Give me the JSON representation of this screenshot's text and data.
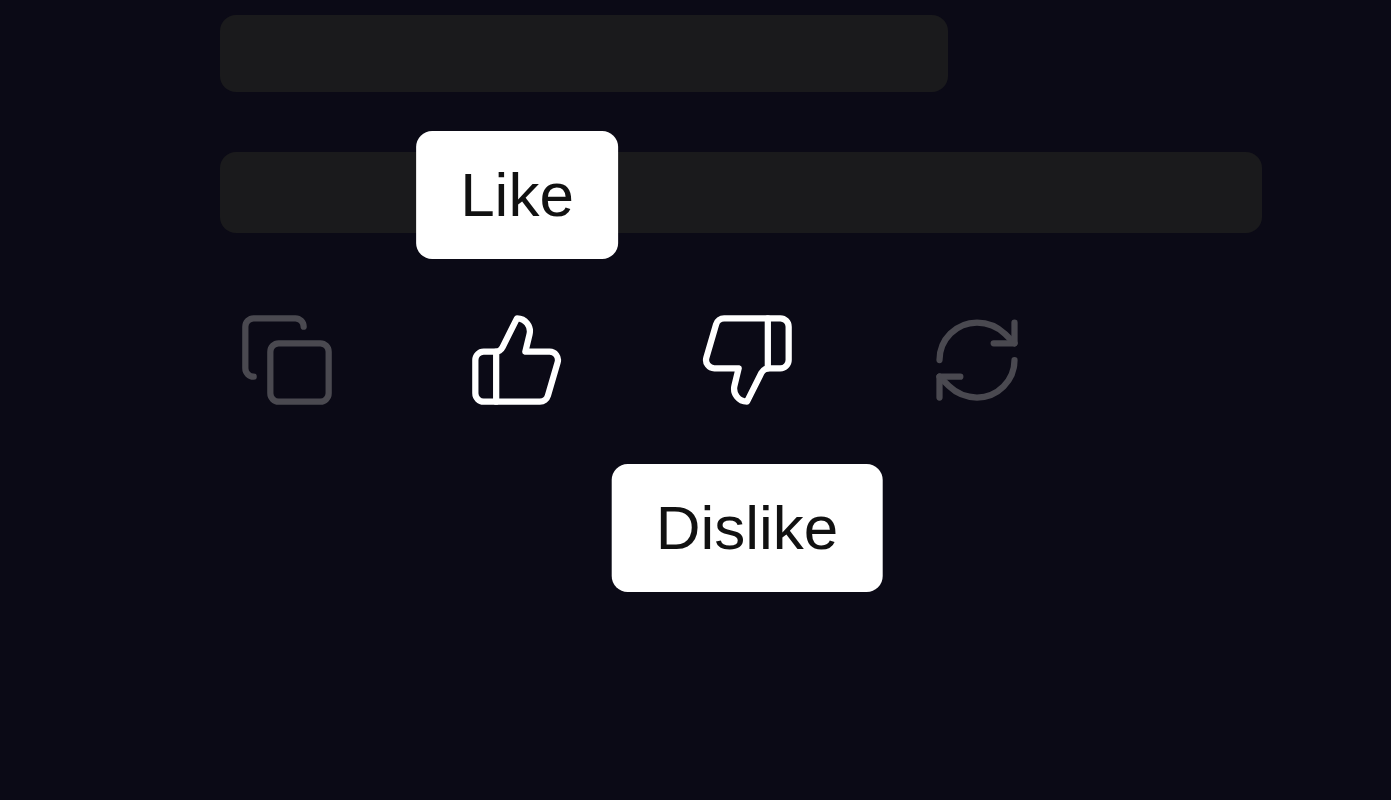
{
  "actions": [
    {
      "kind": "copy",
      "highlighted": false
    },
    {
      "kind": "like",
      "highlighted": true,
      "tooltip": "Like",
      "tooltip_below": false
    },
    {
      "kind": "dislike",
      "highlighted": true,
      "tooltip": "Dislike",
      "tooltip_below": true
    },
    {
      "kind": "regenerate",
      "highlighted": false
    }
  ]
}
